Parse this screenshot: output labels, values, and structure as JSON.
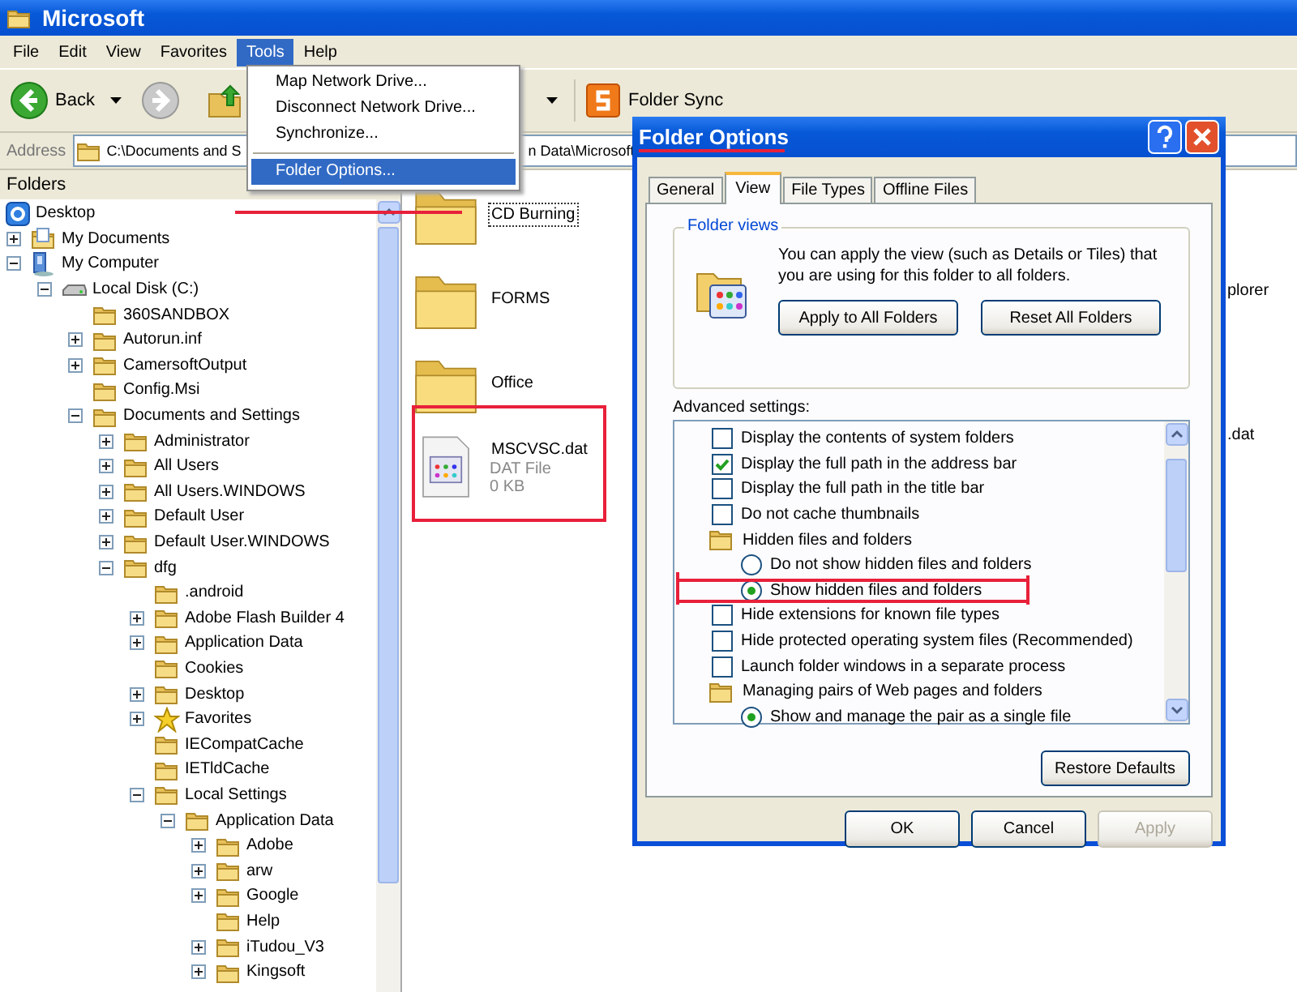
{
  "explorer": {
    "title": "Microsoft",
    "menu": [
      {
        "label": "File",
        "selected": false
      },
      {
        "label": "Edit",
        "selected": false
      },
      {
        "label": "View",
        "selected": false
      },
      {
        "label": "Favorites",
        "selected": false
      },
      {
        "label": "Tools",
        "selected": true
      },
      {
        "label": "Help",
        "selected": false
      }
    ],
    "toolbar": {
      "back": "Back",
      "folder_sync": "Folder Sync"
    },
    "address": {
      "label": "Address",
      "value_start": "C:\\Documents and S",
      "value_end": "n Data\\Microsoft"
    },
    "folders_title": "Folders",
    "tree": [
      {
        "label": "Desktop",
        "kind": "desktop",
        "annotated": true,
        "children": [
          {
            "label": "My Documents",
            "kind": "documents",
            "expanded": false
          },
          {
            "label": "My Computer",
            "kind": "computer",
            "expanded": true,
            "children": [
              {
                "label": "Local Disk (C:)",
                "kind": "drive",
                "expanded": true,
                "children": [
                  {
                    "label": "360SANDBOX",
                    "kind": "folder"
                  },
                  {
                    "label": "Autorun.inf",
                    "kind": "folder",
                    "expanded": false
                  },
                  {
                    "label": "CamersoftOutput",
                    "kind": "folder",
                    "expanded": false
                  },
                  {
                    "label": "Config.Msi",
                    "kind": "folder"
                  },
                  {
                    "label": "Documents and Settings",
                    "kind": "folder",
                    "expanded": true,
                    "children": [
                      {
                        "label": "Administrator",
                        "kind": "folder",
                        "expanded": false
                      },
                      {
                        "label": "All Users",
                        "kind": "folder",
                        "expanded": false
                      },
                      {
                        "label": "All Users.WINDOWS",
                        "kind": "folder",
                        "expanded": false
                      },
                      {
                        "label": "Default User",
                        "kind": "folder",
                        "expanded": false
                      },
                      {
                        "label": "Default User.WINDOWS",
                        "kind": "folder",
                        "expanded": false
                      },
                      {
                        "label": "dfg",
                        "kind": "folder",
                        "expanded": true,
                        "children": [
                          {
                            "label": ".android",
                            "kind": "folder"
                          },
                          {
                            "label": "Adobe Flash Builder 4",
                            "kind": "folder",
                            "expanded": false
                          },
                          {
                            "label": "Application Data",
                            "kind": "folder",
                            "expanded": false
                          },
                          {
                            "label": "Cookies",
                            "kind": "folder"
                          },
                          {
                            "label": "Desktop",
                            "kind": "folder",
                            "expanded": false
                          },
                          {
                            "label": "Favorites",
                            "kind": "favorites",
                            "expanded": false
                          },
                          {
                            "label": "IECompatCache",
                            "kind": "folder"
                          },
                          {
                            "label": "IETldCache",
                            "kind": "folder"
                          },
                          {
                            "label": "Local Settings",
                            "kind": "folder",
                            "expanded": true,
                            "children": [
                              {
                                "label": "Application Data",
                                "kind": "folder",
                                "expanded": true,
                                "children": [
                                  {
                                    "label": "Adobe",
                                    "kind": "folder",
                                    "expanded": false
                                  },
                                  {
                                    "label": "arw",
                                    "kind": "folder",
                                    "expanded": false
                                  },
                                  {
                                    "label": "Google",
                                    "kind": "folder",
                                    "expanded": false
                                  },
                                  {
                                    "label": "Help",
                                    "kind": "folder"
                                  },
                                  {
                                    "label": "iTudou_V3",
                                    "kind": "folder",
                                    "expanded": false
                                  },
                                  {
                                    "label": "Kingsoft",
                                    "kind": "folder",
                                    "expanded": false
                                  }
                                ]
                              }
                            ]
                          }
                        ]
                      }
                    ]
                  }
                ]
              }
            ]
          }
        ]
      }
    ],
    "files": [
      {
        "name": "CD Burning",
        "kind": "folder",
        "focused": true
      },
      {
        "name": "FORMS",
        "kind": "folder",
        "focused": false
      },
      {
        "name": "Office",
        "kind": "folder",
        "focused": false
      },
      {
        "name": "MSCVSC.dat",
        "kind": "file",
        "type": "DAT File",
        "size": "0 KB",
        "focused": false,
        "annotated": true
      }
    ],
    "files_partial": [
      "plorer",
      ".dat"
    ]
  },
  "tools_menu": [
    {
      "kind": "command",
      "label": "Map Network Drive...",
      "selected": false
    },
    {
      "kind": "command",
      "label": "Disconnect Network Drive...",
      "selected": false
    },
    {
      "kind": "command",
      "label": "Synchronize...",
      "selected": false
    },
    {
      "kind": "separator"
    },
    {
      "kind": "command",
      "label": "Folder Options...",
      "selected": true
    }
  ],
  "dialog": {
    "title": "Folder Options",
    "annotated": true,
    "tabs": [
      {
        "label": "General",
        "selected": false
      },
      {
        "label": "View",
        "selected": true
      },
      {
        "label": "File Types",
        "selected": false
      },
      {
        "label": "Offline Files",
        "selected": false
      }
    ],
    "folder_views": {
      "title": "Folder views",
      "text": "You can apply the view (such as Details or Tiles) that you are using for this folder to all folders.",
      "buttons": [
        "Apply to All Folders",
        "Reset All Folders"
      ]
    },
    "advanced_label": "Advanced settings:",
    "advanced": [
      {
        "kind": "checkbox",
        "label": "Display the contents of system folders",
        "checked": false
      },
      {
        "kind": "checkbox",
        "label": "Display the full path in the address bar",
        "checked": true
      },
      {
        "kind": "checkbox",
        "label": "Display the full path in the title bar",
        "checked": false
      },
      {
        "kind": "checkbox",
        "label": "Do not cache thumbnails",
        "checked": false
      },
      {
        "kind": "group",
        "label": "Hidden files and folders"
      },
      {
        "kind": "radio",
        "label": "Do not show hidden files and folders",
        "selected": false
      },
      {
        "kind": "radio",
        "label": "Show hidden files and folders",
        "selected": true,
        "annotated": true
      },
      {
        "kind": "checkbox",
        "label": "Hide extensions for known file types",
        "checked": false
      },
      {
        "kind": "checkbox",
        "label": "Hide protected operating system files (Recommended)",
        "checked": false
      },
      {
        "kind": "checkbox",
        "label": "Launch folder windows in a separate process",
        "checked": false
      },
      {
        "kind": "group",
        "label": "Managing pairs of Web pages and folders"
      },
      {
        "kind": "radio",
        "label": "Show and manage the pair as a single file",
        "selected": true
      }
    ],
    "restore": "Restore Defaults",
    "buttons": [
      {
        "label": "OK",
        "disabled": false
      },
      {
        "label": "Cancel",
        "disabled": false
      },
      {
        "label": "Apply",
        "disabled": true
      }
    ]
  }
}
